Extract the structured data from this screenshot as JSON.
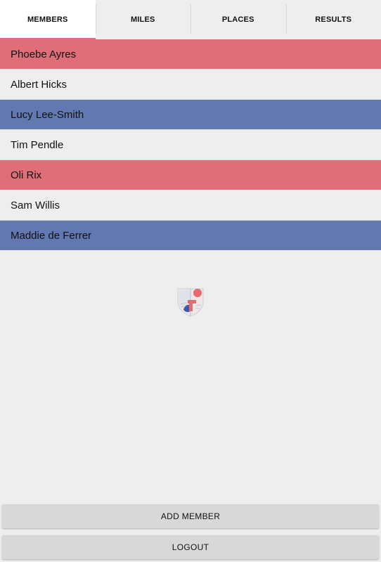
{
  "colors": {
    "accent": "#f06292",
    "red_row": "#df6e79",
    "blue_row": "#6178b1",
    "plain_row": "#eeeeee"
  },
  "tabs": [
    {
      "label": "MEMBERS",
      "active": true
    },
    {
      "label": "MILES",
      "active": false
    },
    {
      "label": "PLACES",
      "active": false
    },
    {
      "label": "RESULTS",
      "active": false
    }
  ],
  "members": [
    {
      "name": "Phoebe Ayres",
      "color": "red"
    },
    {
      "name": "Albert Hicks",
      "color": "plain"
    },
    {
      "name": "Lucy Lee-Smith",
      "color": "blue"
    },
    {
      "name": "Tim Pendle",
      "color": "plain"
    },
    {
      "name": "Oli Rix",
      "color": "red"
    },
    {
      "name": "Sam Willis",
      "color": "plain"
    },
    {
      "name": "Maddie de Ferrer",
      "color": "blue"
    }
  ],
  "logo": {
    "icon": "club-crest-icon"
  },
  "buttons": {
    "add_member": "ADD MEMBER",
    "logout": "LOGOUT"
  }
}
